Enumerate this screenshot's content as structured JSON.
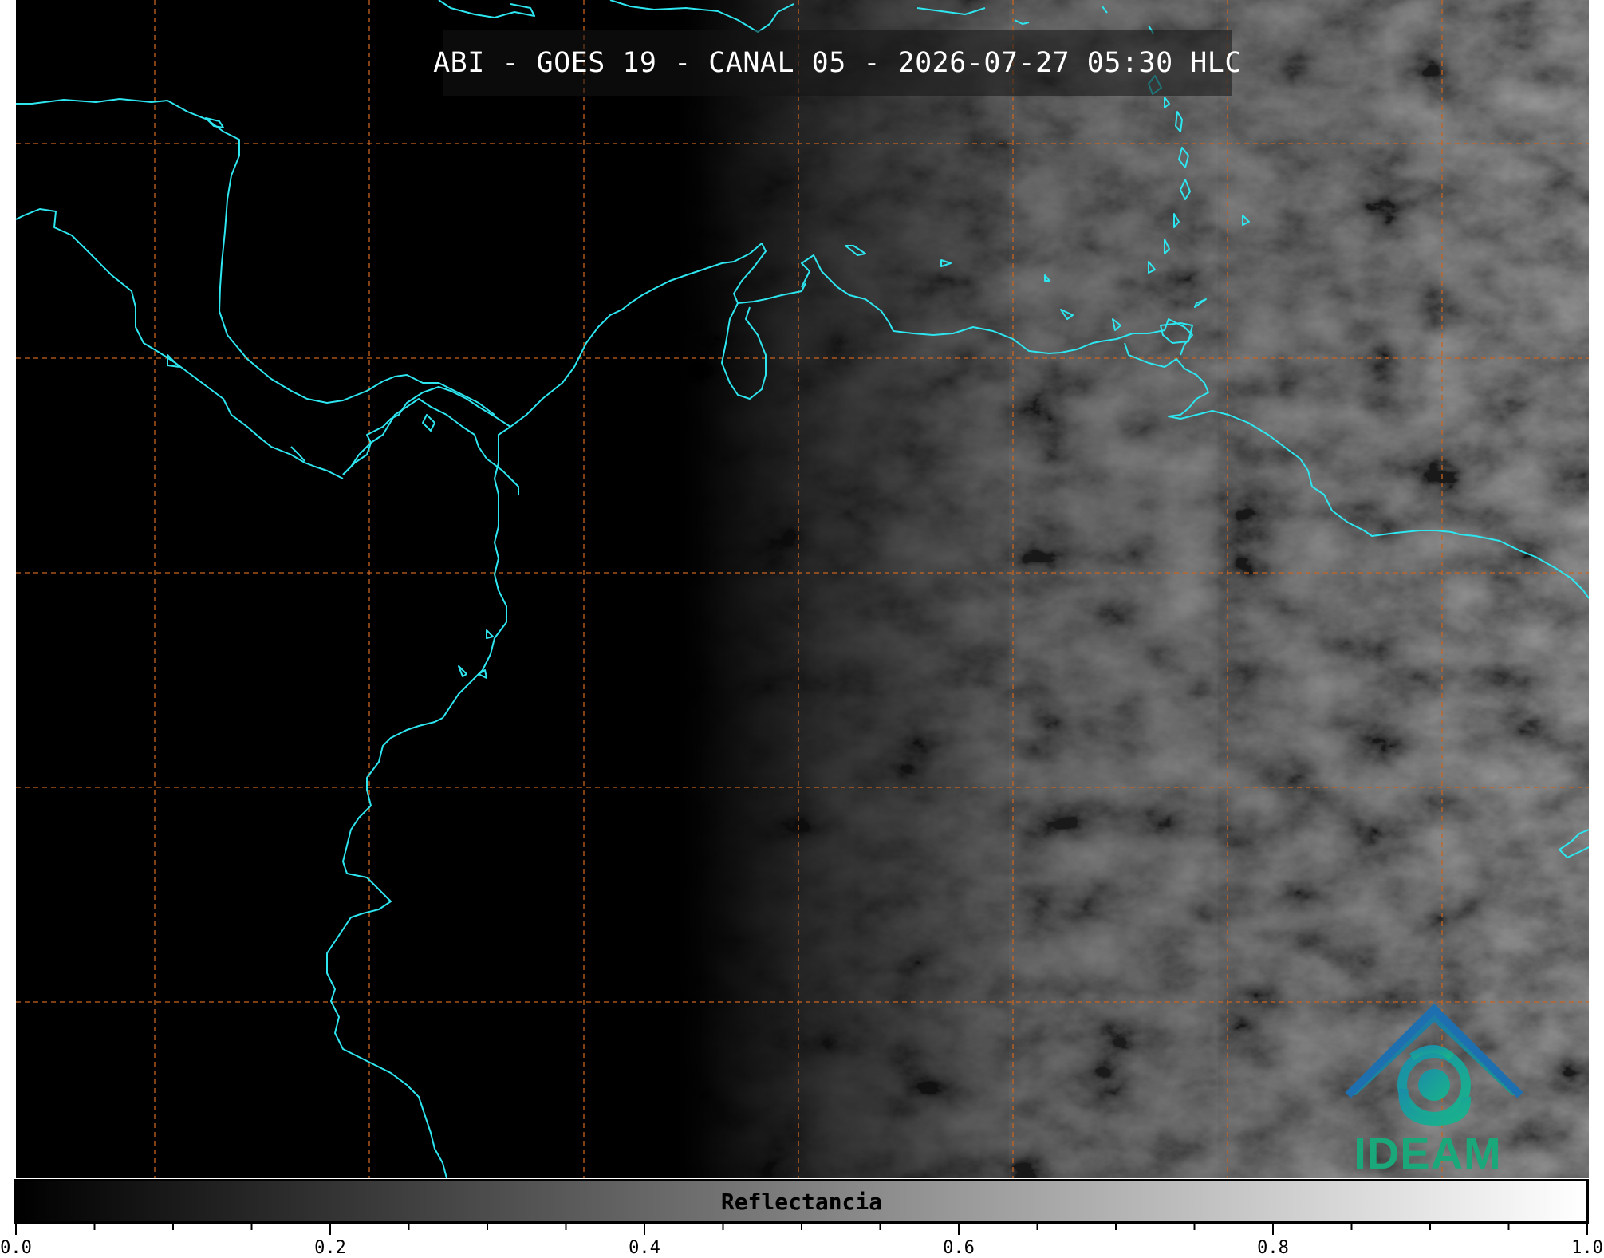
{
  "map": {
    "title": "ABI - GOES 19 - CANAL 05 - 2026-07-27 05:30 HLC",
    "coastline_color": "#2ee6f0",
    "grid_color": "#c8641e",
    "background": "#000000"
  },
  "logo": {
    "text": "IDEAM",
    "colors": {
      "roof": "#1e6fb0",
      "swirl": "#1aa88c",
      "text": "#1aa87a"
    }
  },
  "colorbar": {
    "label": "Reflectancia",
    "range": [
      0.0,
      1.0
    ],
    "tick_labels": [
      "0.0",
      "0.2",
      "0.4",
      "0.6",
      "0.8",
      "1.0"
    ],
    "minor_step": 0.05,
    "colormap": "grayscale black-to-white"
  }
}
